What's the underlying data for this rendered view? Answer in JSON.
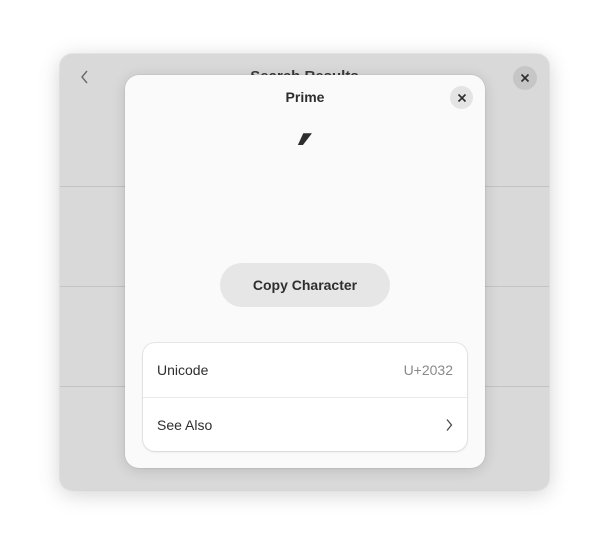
{
  "background_window": {
    "title": "Search Results",
    "back_icon": "chevron-left-icon",
    "close_icon": "close-icon"
  },
  "dialog": {
    "title": "Prime",
    "character": "′",
    "close_icon": "close-icon",
    "copy_button_label": "Copy Character",
    "rows": [
      {
        "label": "Unicode",
        "value": "U+2032"
      },
      {
        "label": "See Also",
        "icon": "chevron-right-icon"
      }
    ]
  }
}
